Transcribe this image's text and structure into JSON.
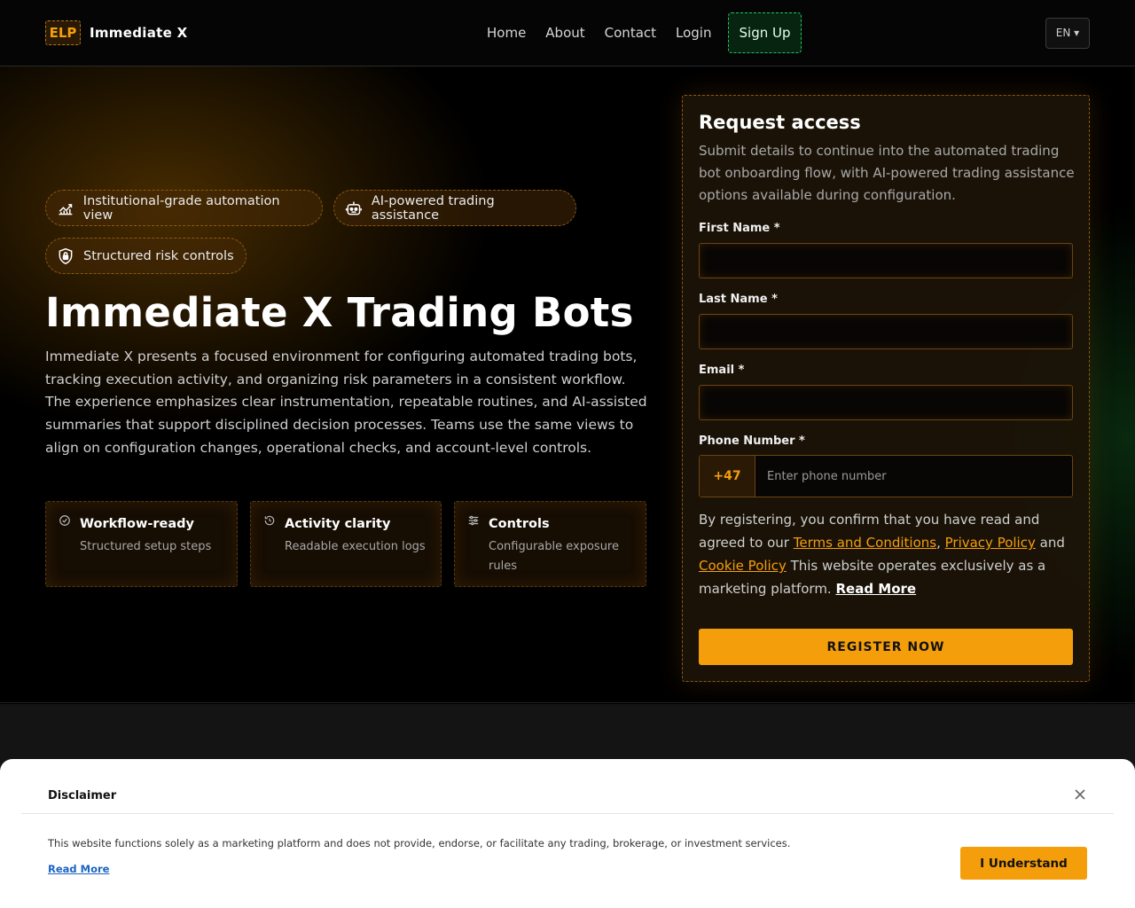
{
  "header": {
    "logo_text": "ELP",
    "brand": "Immediate X",
    "nav": [
      "Home",
      "About",
      "Contact",
      "Login"
    ],
    "signup": "Sign Up",
    "language": "EN ▾"
  },
  "hero": {
    "pills": [
      {
        "label": "Institutional-grade automation view",
        "icon": "chart-icon"
      },
      {
        "label": "AI-powered trading assistance",
        "icon": "robot-icon"
      },
      {
        "label": "Structured risk controls",
        "icon": "shield-lock-icon"
      }
    ],
    "title": "Immediate X Trading Bots",
    "description": "Immediate X presents a focused environment for configuring automated trading bots, tracking execution activity, and organizing risk parameters in a consistent workflow. The experience emphasizes clear instrumentation, repeatable routines, and AI-assisted summaries that support disciplined decision processes. Teams use the same views to align on configuration changes, operational checks, and account-level controls.",
    "features": [
      {
        "title": "Workflow-ready",
        "subtitle": "Structured setup steps",
        "icon": "check-badge-icon"
      },
      {
        "title": "Activity clarity",
        "subtitle": "Readable execution logs",
        "icon": "history-icon"
      },
      {
        "title": "Controls",
        "subtitle": "Configurable exposure rules",
        "icon": "sliders-icon"
      }
    ]
  },
  "form": {
    "title": "Request access",
    "subtitle": "Submit details to continue into the automated trading bot onboarding flow, with AI-powered trading assistance options available during configuration.",
    "first_name_label": "First Name *",
    "last_name_label": "Last Name *",
    "email_label": "Email *",
    "phone_label": "Phone Number *",
    "phone_code": "+47",
    "phone_placeholder": "Enter phone number",
    "consent_1": "By registering, you confirm that you have read and agreed to our ",
    "terms": "Terms and Conditions",
    "comma": ", ",
    "privacy": "Privacy Policy",
    "and": " and ",
    "cookie": "Cookie Policy",
    "consent_2": " This website operates exclusively as a marketing platform. ",
    "read_more": "Read More",
    "register": "REGISTER NOW"
  },
  "disclaimer": {
    "title": "Disclaimer",
    "text": "This website functions solely as a marketing platform and does not provide, endorse, or facilitate any trading, brokerage, or investment services.",
    "read_more": "Read More",
    "button": "I Understand"
  },
  "colors": {
    "accent": "#f59e0b",
    "signup_border": "#22c55e",
    "link_blue": "#1d64c4"
  }
}
